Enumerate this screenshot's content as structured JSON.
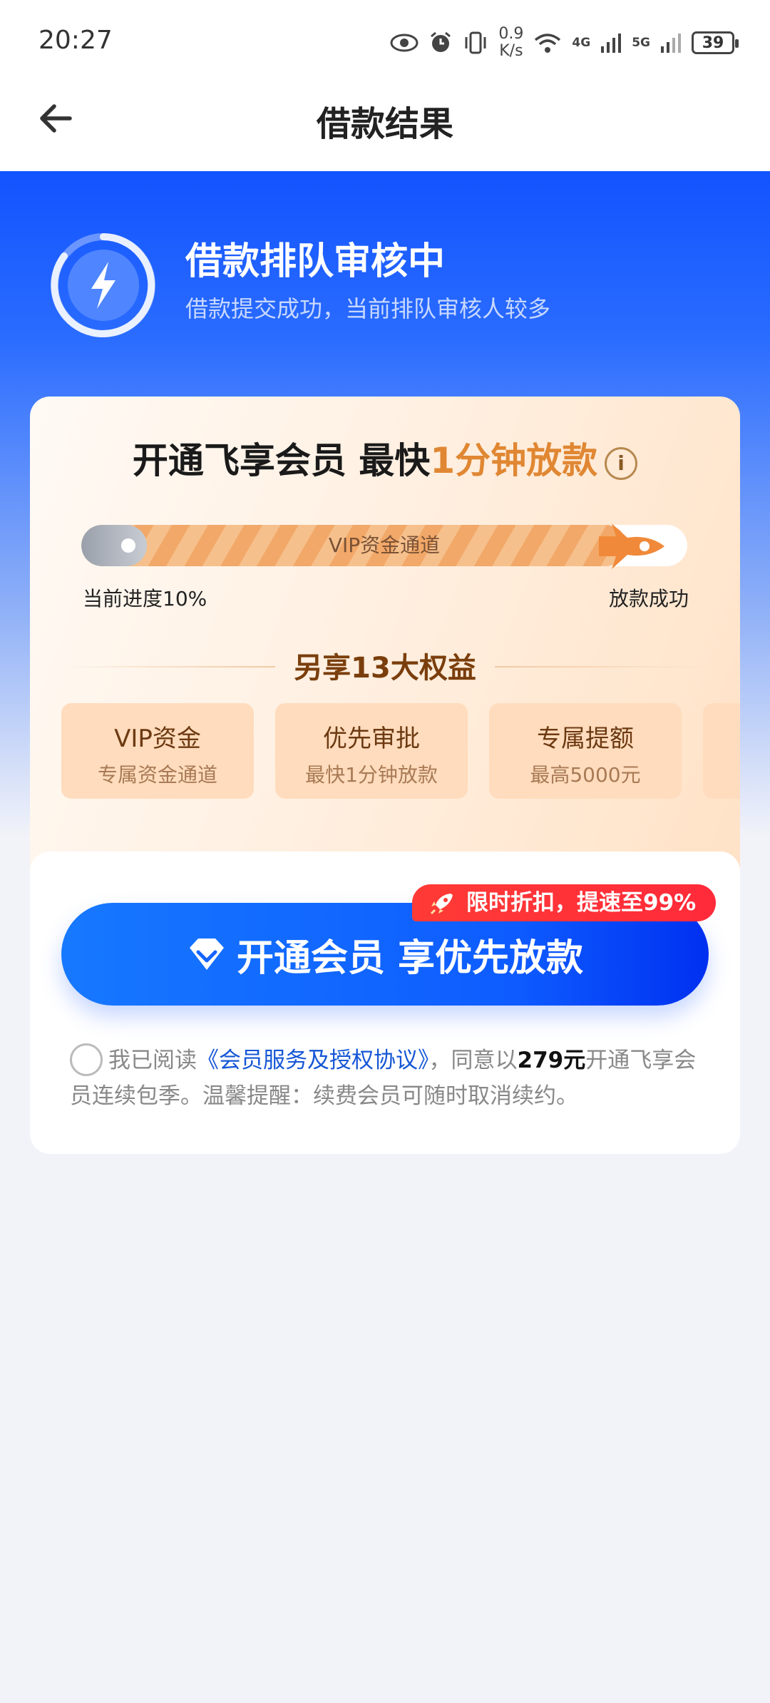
{
  "status": {
    "time": "20:27",
    "speed_value": "0.9",
    "speed_unit": "K/s",
    "net1": "4G",
    "net2": "5G",
    "battery": "39"
  },
  "header": {
    "title": "借款结果"
  },
  "hero": {
    "title": "借款排队审核中",
    "subtitle": "借款提交成功，当前排队审核人较多"
  },
  "promo": {
    "title_pre": "开通飞享会员 最快",
    "title_highlight": "1分钟放款",
    "channel_label": "VIP资金通道",
    "progress_label": "当前进度10%",
    "progress_percent": 10,
    "end_label": "放款成功",
    "benefit_head_pre": "另享",
    "benefit_head_num": "13",
    "benefit_head_post": "大权益",
    "benefits": [
      {
        "name": "VIP资金",
        "desc": "专属资金通道"
      },
      {
        "name": "优先审批",
        "desc": "最快1分钟放款"
      },
      {
        "name": "专属提额",
        "desc": "最高5000元"
      }
    ]
  },
  "cta": {
    "badge": "限时折扣，提速至99%",
    "button": "开通会员 享优先放款",
    "agree_pre": "我已阅读",
    "agree_link": "《会员服务及授权协议》",
    "agree_mid": "，同意以",
    "agree_price": "279元",
    "agree_post": "开通飞享会员连续包季。温馨提醒：续费会员可随时取消续约。"
  },
  "colors": {
    "brand_blue": "#1253ff",
    "accent_orange": "#e08733",
    "badge_red": "#ff3b36"
  },
  "icons": [
    "eye-icon",
    "alarm-icon",
    "vibrate-icon",
    "wifi-icon",
    "signal-icon",
    "back-arrow-icon",
    "lightning-icon",
    "info-icon",
    "rocket-icon",
    "diamond-icon",
    "radio-icon"
  ]
}
